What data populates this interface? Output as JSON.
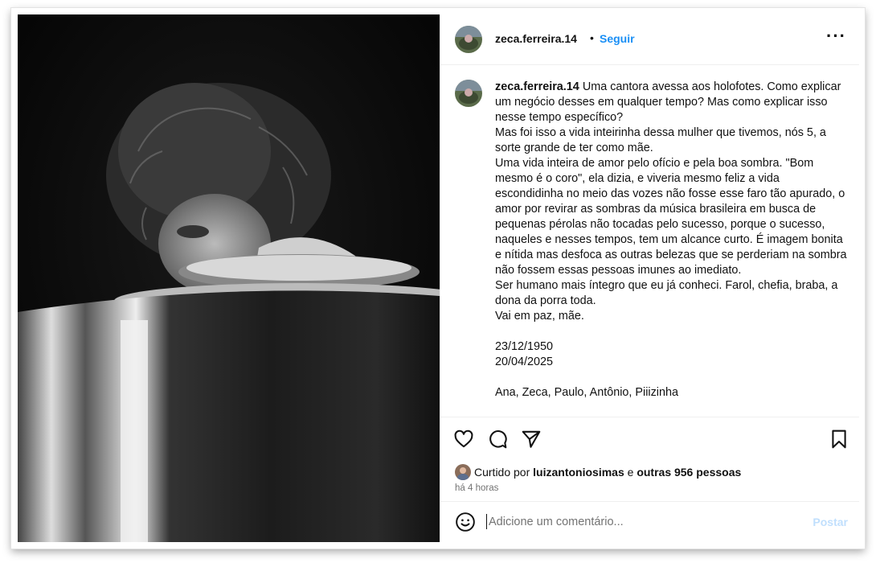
{
  "post": {
    "username": "zeca.ferreira.14",
    "separator": "•",
    "follow_label": "Seguir",
    "more_label": "···"
  },
  "caption": {
    "username": "zeca.ferreira.14",
    "lines": [
      "Uma cantora avessa aos holofotes. Como explicar um negócio desses em qualquer tempo? Mas como explicar isso nesse tempo específico?",
      "Mas foi isso a vida inteirinha dessa mulher que tivemos, nós 5, a sorte grande de ter como mãe.",
      "Uma vida inteira de amor pelo ofício e pela boa sombra. \"Bom mesmo é o coro\", ela dizia, e viveria mesmo feliz a vida escondidinha no meio das vozes não fosse esse faro tão apurado, o amor por revirar as sombras da música brasileira em busca de pequenas pérolas não tocadas pelo sucesso, porque o sucesso, naqueles e nesses tempos, tem um alcance curto. É imagem bonita e nítida mas desfoca as outras belezas que se perderiam na sombra não fossem essas pessoas imunes ao imediato.",
      "Ser humano mais íntegro que eu já conheci. Farol, chefia, braba, a dona da porra toda.",
      "Vai em paz, mãe.",
      "",
      "23/12/1950",
      "20/04/2025",
      "",
      "Ana, Zeca, Paulo, Antônio, Piiizinha"
    ]
  },
  "likes": {
    "prefix": "Curtido por",
    "user": "luizantoniosimas",
    "conj": "e",
    "others": "outras 956 pessoas"
  },
  "timestamp": "há 4 horas",
  "comment": {
    "placeholder": "Adicione um comentário...",
    "post_label": "Postar"
  },
  "icons": {
    "like": "heart-icon",
    "comment": "comment-icon",
    "share": "send-icon",
    "save": "bookmark-icon",
    "emoji": "emoji-icon"
  },
  "colors": {
    "link": "#1a8ff5",
    "post_disabled": "#c0dffd",
    "muted": "#737373"
  }
}
